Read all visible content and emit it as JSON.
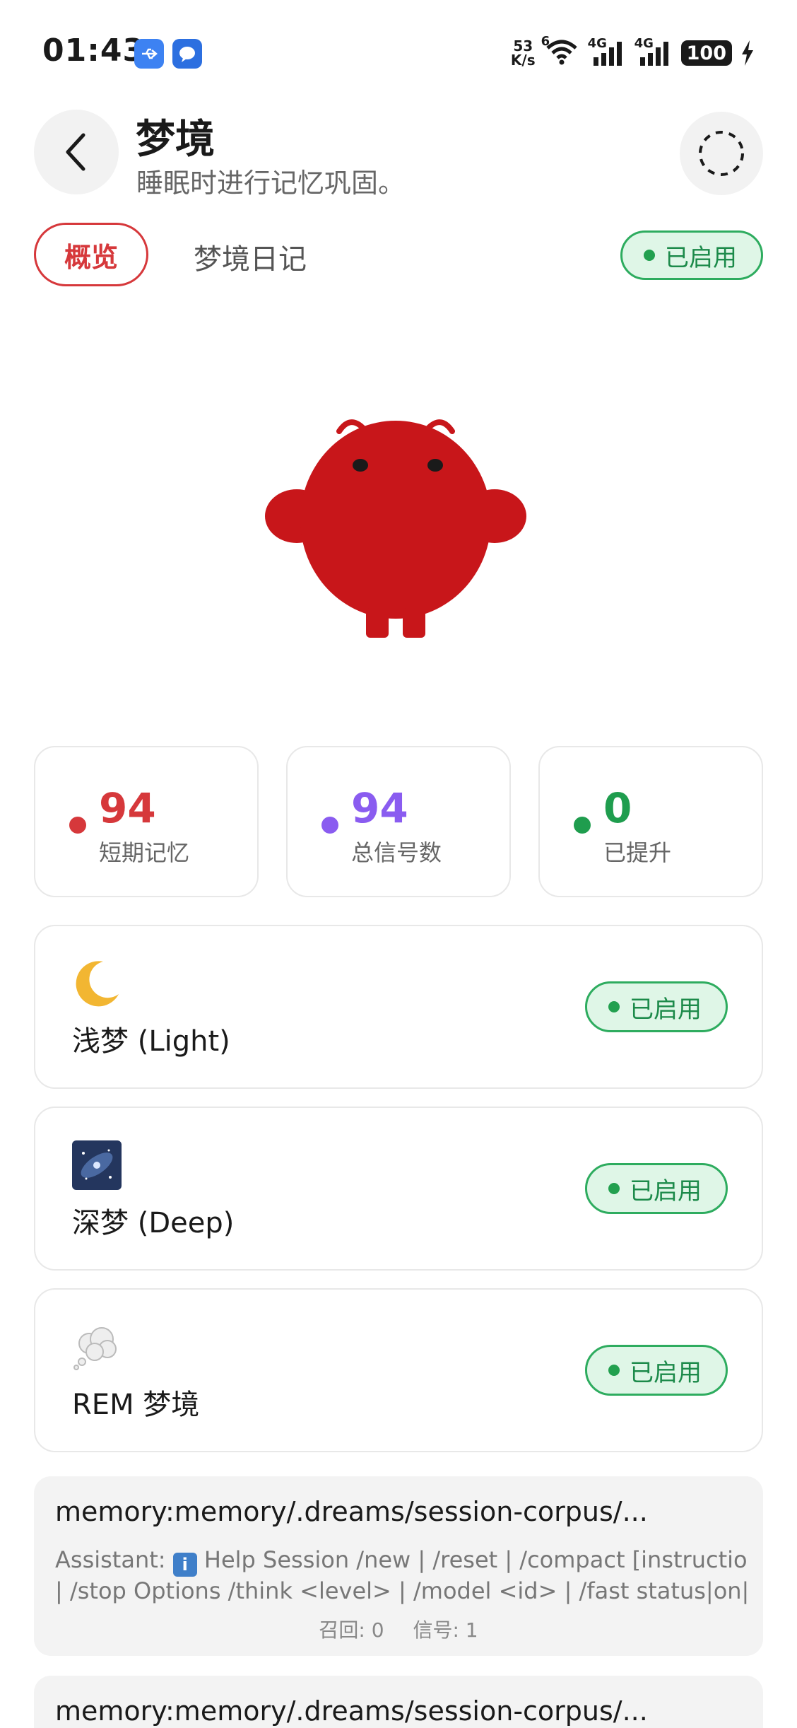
{
  "status_bar": {
    "time": "01:43",
    "net_speed_value": "53",
    "net_speed_unit": "K/s",
    "wifi_label": "6",
    "signal1": "4G",
    "signal2": "4G",
    "battery": "100"
  },
  "header": {
    "title": "梦境",
    "subtitle": "睡眠时进行记忆巩固。",
    "back_icon": "chevron-left-icon",
    "loading_icon": "loading-spinner-icon"
  },
  "tabs": {
    "overview": "概览",
    "diary": "梦境日记"
  },
  "status_badge": "已启用",
  "stats": [
    {
      "value": "94",
      "label": "短期记忆",
      "color": "#d6383b"
    },
    {
      "value": "94",
      "label": "总信号数",
      "color": "#8a5cf0"
    },
    {
      "value": "0",
      "label": "已提升",
      "color": "#1f9d4e"
    }
  ],
  "modes": [
    {
      "icon": "crescent-moon-icon",
      "label": "浅梦 (Light)",
      "badge": "已启用"
    },
    {
      "icon": "galaxy-icon",
      "label": "深梦 (Deep)",
      "badge": "已启用"
    },
    {
      "icon": "thought-bubble-icon",
      "label": "REM 梦境",
      "badge": "已启用"
    }
  ],
  "memories": [
    {
      "title": "memory:memory/.dreams/session-corpus/...",
      "line1_prefix": "Assistant:",
      "line1_rest": "Help Session /new | /reset | /compact [instructions]",
      "line2": "| /stop Options /think <level> | /model <id> | /fast status|on|off | /...",
      "recall": "召回: 0",
      "signal": "信号: 1"
    },
    {
      "title": "memory:memory/.dreams/session-corpus/..."
    }
  ],
  "colors": {
    "accent_red": "#d6383b",
    "badge_green": "#1c8a4a",
    "badge_bg": "#dff6e7"
  }
}
